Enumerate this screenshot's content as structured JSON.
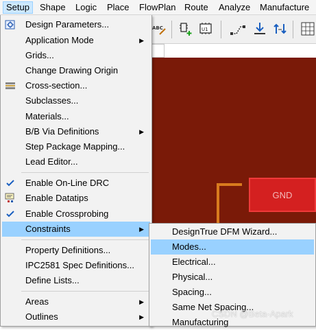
{
  "menubar": {
    "items": [
      "Setup",
      "Shape",
      "Logic",
      "Place",
      "FlowPlan",
      "Route",
      "Analyze",
      "Manufacture"
    ]
  },
  "toolbar": {
    "icons": [
      "abc-icon",
      "add-part-icon",
      "u1-chip-icon",
      "route-icon",
      "fanout-icon",
      "swap-icon",
      "grid-icon"
    ],
    "abc_text": "ABC",
    "u1_text": "U1"
  },
  "canvas": {
    "pad_label": "GND",
    "background": "#7a1a08",
    "pad_color": "#d42020",
    "trace_color": "#d97b1e"
  },
  "setup_menu": {
    "items": [
      {
        "label": "Design Parameters...",
        "icon": "design-parameters-icon",
        "submenu": false
      },
      {
        "label": "Application Mode",
        "submenu": true
      },
      {
        "label": "Grids...",
        "submenu": false
      },
      {
        "label": "Change Drawing Origin",
        "submenu": false
      },
      {
        "label": "Cross-section...",
        "icon": "cross-section-icon",
        "submenu": false
      },
      {
        "label": "Subclasses...",
        "submenu": false
      },
      {
        "label": "Materials...",
        "submenu": false
      },
      {
        "label": "B/B Via Definitions",
        "submenu": true
      },
      {
        "label": "Step Package Mapping...",
        "submenu": false
      },
      {
        "label": "Lead Editor...",
        "submenu": false
      },
      {
        "label": "Enable On-Line DRC",
        "icon": "check-icon",
        "checked": true
      },
      {
        "label": "Enable Datatips",
        "icon": "datatips-icon"
      },
      {
        "label": "Enable Crossprobing",
        "icon": "check-icon",
        "checked": true
      },
      {
        "label": "Constraints",
        "submenu": true,
        "highlighted": true
      },
      {
        "label": "Property Definitions...",
        "submenu": false
      },
      {
        "label": "IPC2581 Spec Definitions...",
        "submenu": false
      },
      {
        "label": "Define Lists...",
        "submenu": false
      },
      {
        "label": "Areas",
        "submenu": true
      },
      {
        "label": "Outlines",
        "submenu": true
      }
    ]
  },
  "constraints_submenu": {
    "items": [
      {
        "label": "DesignTrue DFM Wizard..."
      },
      {
        "label": "Modes...",
        "highlighted": true
      },
      {
        "label": "Electrical..."
      },
      {
        "label": "Physical..."
      },
      {
        "label": "Spacing..."
      },
      {
        "label": "Same Net Spacing..."
      },
      {
        "label": "Manufacturing"
      }
    ]
  },
  "watermark": "CSDN @Beta-Apark"
}
